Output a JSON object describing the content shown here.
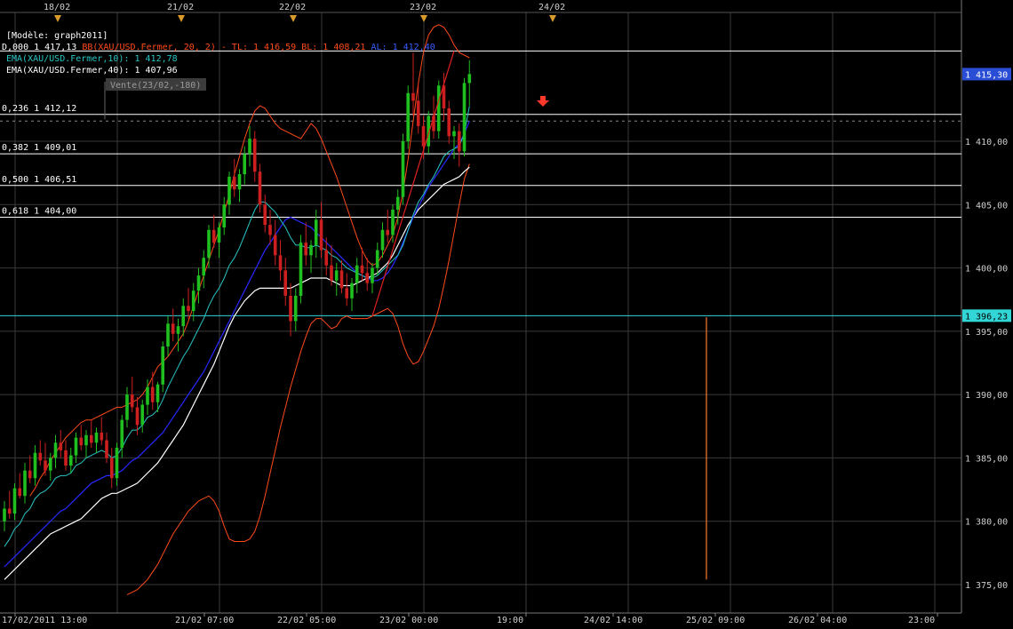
{
  "model_label": "[Modèle: graph2011]",
  "indicators": {
    "bollinger_name": "BB(XAU/USD.Fermer, 20, 2)",
    "bollinger_prefix_value": "D,000 1 417,13",
    "tl_label": "TL: 1 416,59",
    "bl_label": "BL: 1 408,21",
    "al_label": "AL: 1 412,40",
    "ema10": "EMA(XAU/USD.Fermer,10): 1 412,78",
    "ema40": "EMA(XAU/USD.Fermer,40): 1 407,96"
  },
  "sell_tag": "Vente(23/02,-180)",
  "colors": {
    "background": "#000000",
    "grid": "#3a3a3a",
    "up_candle": "#1fbf1f",
    "down_candle": "#cc1f1f",
    "bollinger": "#ff4a1a",
    "ema10": "#29c6c6",
    "ema_blue": "#2828ff",
    "ema40": "#ffffff",
    "fib_line": "#ffffff",
    "level_line": "#33d6d6",
    "trend_line": "#e02020",
    "price_tag_bg": "#2a4dd6",
    "level_tag_bg": "#33d6d6",
    "marker_orange": "#ff7a2a"
  },
  "chart_data": {
    "type": "line",
    "instrument": "XAU/USD",
    "ylim": [
      1373,
      1421
    ],
    "y_ticks": [
      {
        "value": 1375,
        "label": "1 375,00"
      },
      {
        "value": 1380,
        "label": "1 380,00"
      },
      {
        "value": 1385,
        "label": "1 385,00"
      },
      {
        "value": 1390,
        "label": "1 390,00"
      },
      {
        "value": 1395,
        "label": "1 395,00"
      },
      {
        "value": 1400,
        "label": "1 400,00"
      },
      {
        "value": 1405,
        "label": "1 405,00"
      },
      {
        "value": 1410,
        "label": "1 410,00"
      }
    ],
    "x_ticks": [
      "17/02/2011 13:00",
      "21/02 07:00",
      "22/02 05:00",
      "23/02 00:00",
      "19:00",
      "24/02 14:00",
      "25/02 09:00",
      "26/02 04:00",
      "23:00"
    ],
    "day_markers": [
      "18/02",
      "21/02",
      "22/02",
      "23/02",
      "24/02"
    ],
    "current_price": {
      "value": 1415.3,
      "label": "1 415,30"
    },
    "level": {
      "value": 1396.23,
      "label": "1 396,23"
    },
    "fibonacci": [
      {
        "ratio": "0,236",
        "value": 1412.12,
        "label": "0,236 1 412,12"
      },
      {
        "ratio": "0,382",
        "value": 1409.01,
        "label": "0,382 1 409,01"
      },
      {
        "ratio": "0,500",
        "value": 1406.51,
        "label": "0,500 1 406,51"
      },
      {
        "ratio": "0,618",
        "value": 1404.0,
        "label": "0,618 1 404,00"
      }
    ],
    "top_level": 1417.13,
    "dashed_level": 1411.6,
    "vertical_marker": {
      "x_bar": 138,
      "y_from": 1396.1,
      "y_to": 1375.4
    },
    "trend_line": {
      "from": [
        72,
        1396.2
      ],
      "to": [
        88,
        1417.13
      ]
    },
    "sell_signal": {
      "x_bar": 105,
      "y": 1413.3
    },
    "candles": [
      [
        1380.0,
        1381.6,
        1379.2,
        1381.0
      ],
      [
        1381.0,
        1382.4,
        1380.2,
        1380.6
      ],
      [
        1380.6,
        1383.0,
        1380.1,
        1382.6
      ],
      [
        1382.6,
        1383.8,
        1381.8,
        1382.0
      ],
      [
        1382.0,
        1384.6,
        1381.4,
        1384.0
      ],
      [
        1384.0,
        1385.2,
        1383.0,
        1383.4
      ],
      [
        1383.4,
        1386.0,
        1382.8,
        1385.4
      ],
      [
        1385.4,
        1386.4,
        1384.4,
        1384.8
      ],
      [
        1384.8,
        1386.2,
        1383.6,
        1384.0
      ],
      [
        1384.0,
        1385.4,
        1383.2,
        1385.0
      ],
      [
        1385.0,
        1386.8,
        1384.2,
        1386.2
      ],
      [
        1386.2,
        1387.2,
        1385.0,
        1385.6
      ],
      [
        1385.6,
        1386.4,
        1384.0,
        1384.4
      ],
      [
        1384.4,
        1385.8,
        1383.8,
        1385.2
      ],
      [
        1385.2,
        1387.0,
        1384.6,
        1386.6
      ],
      [
        1386.6,
        1387.6,
        1385.6,
        1386.0
      ],
      [
        1386.0,
        1387.2,
        1385.0,
        1386.8
      ],
      [
        1386.8,
        1388.0,
        1385.8,
        1386.2
      ],
      [
        1386.2,
        1387.4,
        1385.4,
        1387.0
      ],
      [
        1387.0,
        1388.2,
        1386.0,
        1386.4
      ],
      [
        1386.4,
        1387.0,
        1384.6,
        1385.0
      ],
      [
        1385.0,
        1385.8,
        1382.6,
        1383.4
      ],
      [
        1383.4,
        1386.2,
        1382.8,
        1385.8
      ],
      [
        1385.8,
        1388.4,
        1385.0,
        1388.0
      ],
      [
        1388.0,
        1390.6,
        1387.4,
        1390.0
      ],
      [
        1390.0,
        1391.4,
        1388.6,
        1389.0
      ],
      [
        1389.0,
        1389.8,
        1386.8,
        1387.6
      ],
      [
        1387.6,
        1389.6,
        1387.0,
        1389.2
      ],
      [
        1389.2,
        1391.2,
        1388.4,
        1390.6
      ],
      [
        1390.6,
        1391.8,
        1388.8,
        1389.4
      ],
      [
        1389.4,
        1391.0,
        1388.6,
        1390.8
      ],
      [
        1390.8,
        1394.2,
        1390.2,
        1393.8
      ],
      [
        1393.8,
        1396.2,
        1393.0,
        1395.6
      ],
      [
        1395.6,
        1396.8,
        1394.2,
        1394.8
      ],
      [
        1394.8,
        1396.0,
        1393.4,
        1395.4
      ],
      [
        1395.4,
        1397.6,
        1394.6,
        1397.0
      ],
      [
        1397.0,
        1398.4,
        1396.0,
        1396.6
      ],
      [
        1396.6,
        1398.8,
        1395.8,
        1398.2
      ],
      [
        1398.2,
        1400.0,
        1397.2,
        1399.4
      ],
      [
        1399.4,
        1401.4,
        1398.4,
        1400.8
      ],
      [
        1400.8,
        1403.4,
        1400.0,
        1403.0
      ],
      [
        1403.0,
        1404.2,
        1401.6,
        1402.0
      ],
      [
        1402.0,
        1403.6,
        1400.8,
        1403.2
      ],
      [
        1403.2,
        1405.6,
        1402.6,
        1405.0
      ],
      [
        1405.0,
        1407.6,
        1404.2,
        1407.2
      ],
      [
        1407.2,
        1408.6,
        1405.6,
        1406.2
      ],
      [
        1406.2,
        1407.8,
        1405.2,
        1407.4
      ],
      [
        1407.4,
        1409.6,
        1406.6,
        1409.0
      ],
      [
        1409.0,
        1411.2,
        1408.0,
        1410.2
      ],
      [
        1410.2,
        1410.8,
        1406.8,
        1407.6
      ],
      [
        1407.6,
        1408.2,
        1404.4,
        1405.0
      ],
      [
        1405.0,
        1405.8,
        1402.8,
        1403.4
      ],
      [
        1403.4,
        1404.6,
        1401.8,
        1402.6
      ],
      [
        1402.6,
        1403.8,
        1400.2,
        1401.0
      ],
      [
        1401.0,
        1402.2,
        1399.0,
        1399.8
      ],
      [
        1399.8,
        1400.8,
        1397.0,
        1397.8
      ],
      [
        1397.8,
        1398.8,
        1394.6,
        1395.8
      ],
      [
        1395.8,
        1398.4,
        1395.0,
        1397.8
      ],
      [
        1397.8,
        1402.6,
        1397.2,
        1402.0
      ],
      [
        1402.0,
        1403.6,
        1400.2,
        1401.0
      ],
      [
        1401.0,
        1402.2,
        1399.6,
        1401.8
      ],
      [
        1401.8,
        1404.6,
        1400.8,
        1403.8
      ],
      [
        1403.8,
        1405.2,
        1400.8,
        1401.4
      ],
      [
        1401.4,
        1402.4,
        1399.4,
        1400.2
      ],
      [
        1400.2,
        1401.8,
        1398.6,
        1399.0
      ],
      [
        1399.0,
        1400.4,
        1397.8,
        1399.8
      ],
      [
        1399.8,
        1400.6,
        1398.0,
        1398.4
      ],
      [
        1398.4,
        1399.6,
        1397.0,
        1397.6
      ],
      [
        1397.6,
        1399.2,
        1396.6,
        1398.8
      ],
      [
        1398.8,
        1400.8,
        1398.0,
        1400.2
      ],
      [
        1400.2,
        1401.6,
        1399.0,
        1399.6
      ],
      [
        1399.6,
        1400.8,
        1398.2,
        1398.8
      ],
      [
        1398.8,
        1400.4,
        1398.0,
        1400.0
      ],
      [
        1400.0,
        1402.0,
        1399.4,
        1401.4
      ],
      [
        1401.4,
        1403.6,
        1400.8,
        1403.0
      ],
      [
        1403.0,
        1404.6,
        1402.0,
        1402.6
      ],
      [
        1402.6,
        1405.0,
        1402.0,
        1404.6
      ],
      [
        1404.6,
        1406.2,
        1403.4,
        1405.6
      ],
      [
        1405.6,
        1410.6,
        1405.0,
        1410.0
      ],
      [
        1410.0,
        1414.4,
        1409.4,
        1413.8
      ],
      [
        1413.8,
        1417.0,
        1412.0,
        1413.2
      ],
      [
        1413.2,
        1414.6,
        1410.6,
        1411.2
      ],
      [
        1411.2,
        1412.0,
        1408.6,
        1409.6
      ],
      [
        1409.6,
        1412.4,
        1409.0,
        1412.0
      ],
      [
        1412.0,
        1413.6,
        1410.2,
        1410.8
      ],
      [
        1410.8,
        1414.8,
        1410.2,
        1414.4
      ],
      [
        1414.4,
        1415.4,
        1411.6,
        1412.6
      ],
      [
        1412.6,
        1413.2,
        1409.8,
        1410.4
      ],
      [
        1410.4,
        1411.2,
        1408.6,
        1410.8
      ],
      [
        1410.8,
        1411.4,
        1408.0,
        1409.2
      ],
      [
        1409.2,
        1415.0,
        1408.8,
        1414.6
      ],
      [
        1414.6,
        1416.4,
        1412.8,
        1415.3
      ]
    ],
    "ema10_values": [
      1378.0,
      1378.6,
      1379.4,
      1379.8,
      1380.6,
      1381.0,
      1381.8,
      1382.2,
      1382.4,
      1382.8,
      1383.4,
      1383.6,
      1383.6,
      1383.8,
      1384.4,
      1384.6,
      1385.0,
      1385.2,
      1385.4,
      1385.6,
      1385.4,
      1385.0,
      1385.2,
      1385.8,
      1386.6,
      1387.2,
      1387.2,
      1387.6,
      1388.2,
      1388.4,
      1388.8,
      1389.6,
      1390.6,
      1391.4,
      1392.2,
      1393.0,
      1393.6,
      1394.4,
      1395.2,
      1396.0,
      1397.0,
      1397.8,
      1398.4,
      1399.2,
      1400.2,
      1400.8,
      1401.6,
      1402.6,
      1403.6,
      1404.6,
      1405.2,
      1405.2,
      1404.8,
      1404.4,
      1403.8,
      1403.2,
      1402.4,
      1401.8,
      1401.8,
      1401.6,
      1401.6,
      1401.8,
      1401.6,
      1401.4,
      1401.0,
      1400.8,
      1400.4,
      1400.0,
      1399.8,
      1399.6,
      1399.4,
      1399.2,
      1399.2,
      1399.4,
      1399.8,
      1400.2,
      1400.6,
      1401.0,
      1401.8,
      1403.0,
      1404.2,
      1405.2,
      1405.8,
      1406.6,
      1407.2,
      1408.0,
      1408.8,
      1409.2,
      1409.4,
      1409.6,
      1410.6,
      1412.78
    ],
    "ema_blue_values": [
      1376.4,
      1376.8,
      1377.2,
      1377.6,
      1378.0,
      1378.4,
      1378.8,
      1379.2,
      1379.6,
      1380.0,
      1380.4,
      1380.8,
      1381.0,
      1381.4,
      1381.8,
      1382.2,
      1382.6,
      1383.0,
      1383.2,
      1383.4,
      1383.6,
      1383.6,
      1383.8,
      1384.0,
      1384.4,
      1384.8,
      1385.0,
      1385.4,
      1385.8,
      1386.2,
      1386.6,
      1387.0,
      1387.6,
      1388.2,
      1388.8,
      1389.4,
      1390.0,
      1390.6,
      1391.2,
      1391.8,
      1392.6,
      1393.4,
      1394.2,
      1395.0,
      1395.8,
      1396.6,
      1397.4,
      1398.2,
      1399.0,
      1399.8,
      1400.6,
      1401.4,
      1402.0,
      1402.6,
      1403.2,
      1403.8,
      1404.0,
      1403.8,
      1403.6,
      1403.4,
      1403.2,
      1402.8,
      1402.4,
      1402.0,
      1401.6,
      1401.2,
      1400.8,
      1400.4,
      1400.0,
      1399.6,
      1399.4,
      1399.2,
      1399.0,
      1399.0,
      1399.2,
      1399.6,
      1400.2,
      1401.0,
      1402.0,
      1403.0,
      1404.0,
      1404.8,
      1405.6,
      1406.4,
      1407.0,
      1407.6,
      1408.2,
      1408.8,
      1409.4,
      1409.8,
      1410.6,
      1411.6
    ],
    "ema40_values": [
      1375.4,
      1375.8,
      1376.2,
      1376.6,
      1377.0,
      1377.4,
      1377.8,
      1378.2,
      1378.6,
      1379.0,
      1379.2,
      1379.4,
      1379.6,
      1379.8,
      1380.0,
      1380.2,
      1380.6,
      1381.0,
      1381.4,
      1381.8,
      1382.0,
      1382.2,
      1382.2,
      1382.4,
      1382.6,
      1382.8,
      1383.0,
      1383.4,
      1383.8,
      1384.2,
      1384.6,
      1385.2,
      1385.8,
      1386.4,
      1387.0,
      1387.6,
      1388.4,
      1389.2,
      1390.0,
      1390.8,
      1391.6,
      1392.4,
      1393.4,
      1394.4,
      1395.4,
      1396.2,
      1396.8,
      1397.4,
      1397.8,
      1398.2,
      1398.4,
      1398.4,
      1398.4,
      1398.4,
      1398.4,
      1398.4,
      1398.4,
      1398.6,
      1398.8,
      1399.0,
      1399.2,
      1399.2,
      1399.2,
      1399.2,
      1399.0,
      1398.8,
      1398.6,
      1398.6,
      1398.6,
      1398.8,
      1399.0,
      1399.2,
      1399.4,
      1399.6,
      1400.0,
      1400.4,
      1401.0,
      1401.8,
      1402.6,
      1403.4,
      1404.0,
      1404.6,
      1405.0,
      1405.4,
      1405.8,
      1406.2,
      1406.6,
      1406.8,
      1407.0,
      1407.2,
      1407.6,
      1407.96
    ],
    "bb_upper_values": [
      1382.0,
      1382.6,
      1383.4,
      1384.0,
      1384.8,
      1385.4,
      1386.0,
      1386.6,
      1387.0,
      1387.4,
      1387.8,
      1388.0,
      1388.0,
      1388.2,
      1388.4,
      1388.6,
      1388.8,
      1389.0,
      1389.0,
      1389.2,
      1389.4,
      1389.6,
      1390.0,
      1390.6,
      1391.4,
      1392.2,
      1392.6,
      1393.0,
      1393.6,
      1394.2,
      1394.8,
      1395.8,
      1397.0,
      1398.2,
      1399.4,
      1400.6,
      1401.8,
      1403.0,
      1404.4,
      1405.8,
      1407.4,
      1408.8,
      1410.2,
      1411.4,
      1412.4,
      1412.8,
      1412.6,
      1412.0,
      1411.4,
      1411.0,
      1410.8,
      1410.6,
      1410.4,
      1410.2,
      1410.8,
      1411.4,
      1411.0,
      1410.2,
      1409.2,
      1408.2,
      1407.2,
      1406.0,
      1404.8,
      1403.6,
      1402.4,
      1401.4,
      1400.6,
      1400.2,
      1400.4,
      1401.0,
      1401.8,
      1402.6,
      1404.0,
      1406.0,
      1408.6,
      1411.6,
      1414.6,
      1417.0,
      1418.4,
      1419.0,
      1419.2,
      1419.0,
      1418.4,
      1417.6,
      1417.0,
      1416.8,
      1416.59
    ],
    "bb_lower_values": [
      1374.2,
      1374.4,
      1374.6,
      1375.0,
      1375.4,
      1376.0,
      1376.6,
      1377.4,
      1378.2,
      1379.0,
      1379.6,
      1380.2,
      1380.8,
      1381.2,
      1381.6,
      1381.8,
      1382.0,
      1381.6,
      1380.8,
      1379.6,
      1378.6,
      1378.4,
      1378.4,
      1378.4,
      1378.6,
      1379.2,
      1380.4,
      1382.0,
      1383.8,
      1385.6,
      1387.4,
      1389.0,
      1390.6,
      1392.0,
      1393.4,
      1394.6,
      1395.6,
      1396.0,
      1396.0,
      1395.6,
      1395.2,
      1395.4,
      1396.0,
      1396.2,
      1396.0,
      1396.0,
      1396.0,
      1396.0,
      1396.2,
      1396.4,
      1396.6,
      1396.8,
      1396.4,
      1395.4,
      1394.0,
      1393.0,
      1392.4,
      1392.6,
      1393.4,
      1394.4,
      1395.4,
      1396.8,
      1398.6,
      1400.6,
      1402.8,
      1405.0,
      1407.0,
      1408.21
    ],
    "bb_lower_start": 24,
    "bb_upper_start": 5
  }
}
